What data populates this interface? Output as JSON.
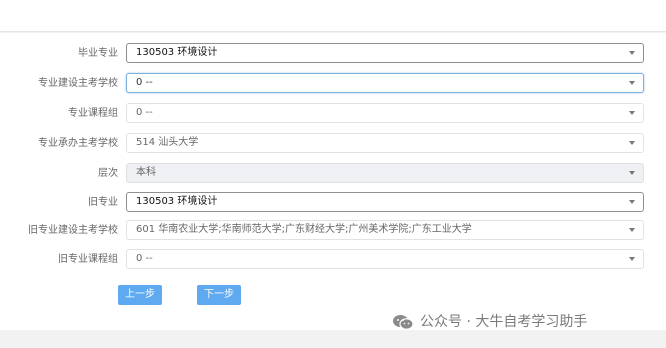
{
  "form": {
    "rows": [
      {
        "label": "毕业专业",
        "value": "130503 环境设计"
      },
      {
        "label": "专业建设主考学校",
        "value": "0 --"
      },
      {
        "label": "专业课程组",
        "value": "0 --"
      },
      {
        "label": "专业承办主考学校",
        "value": "514 汕头大学"
      },
      {
        "label": "层次",
        "value": "本科"
      },
      {
        "label": "旧专业",
        "value": "130503 环境设计"
      },
      {
        "label": "旧专业建设主考学校",
        "value": "601 华南农业大学;华南师范大学;广东财经大学;广州美术学院;广东工业大学"
      },
      {
        "label": "旧专业课程组",
        "value": "0 --"
      }
    ]
  },
  "buttons": {
    "prev": "上一步",
    "next": "下一步"
  },
  "watermark": {
    "text": "公众号 · 大牛自考学习助手"
  },
  "colors": {
    "button": "#5ea9f0",
    "focus_border": "#7fb1e0"
  }
}
